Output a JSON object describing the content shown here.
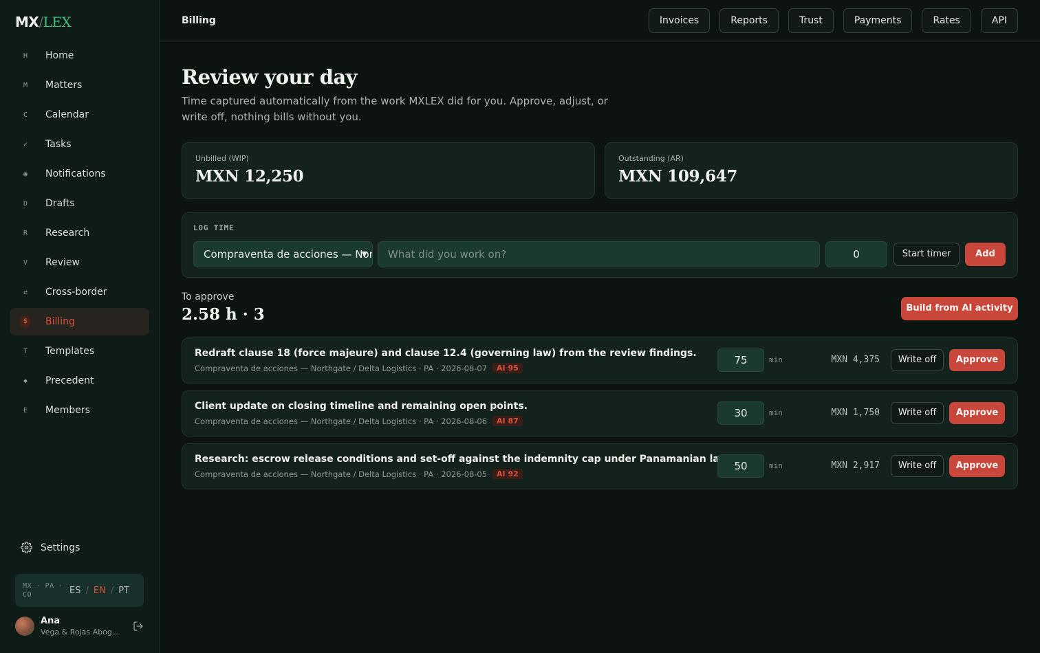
{
  "brand": {
    "mx": "MX",
    "slash": "/",
    "lex": "LEX"
  },
  "sidebar": {
    "items": [
      {
        "icon": "H",
        "label": "Home"
      },
      {
        "icon": "M",
        "label": "Matters"
      },
      {
        "icon": "C",
        "label": "Calendar"
      },
      {
        "icon": "✓",
        "label": "Tasks"
      },
      {
        "icon": "◉",
        "label": "Notifications"
      },
      {
        "icon": "D",
        "label": "Drafts"
      },
      {
        "icon": "R",
        "label": "Research"
      },
      {
        "icon": "V",
        "label": "Review"
      },
      {
        "icon": "⇄",
        "label": "Cross-border"
      },
      {
        "icon": "$",
        "label": "Billing",
        "active": true
      },
      {
        "icon": "T",
        "label": "Templates"
      },
      {
        "icon": "◆",
        "label": "Precedent"
      },
      {
        "icon": "E",
        "label": "Members"
      }
    ],
    "settings_label": "Settings",
    "regions": "MX · PA · CO",
    "languages": [
      "ES",
      "EN",
      "PT"
    ],
    "active_language": "EN",
    "user": {
      "name": "Ana",
      "firm": "Vega & Rojas Abog..."
    }
  },
  "topbar": {
    "breadcrumb": "Billing",
    "tabs": [
      "Invoices",
      "Reports",
      "Trust",
      "Payments",
      "Rates",
      "API"
    ]
  },
  "page": {
    "title": "Review your day",
    "subtitle": "Time captured automatically from the work MXLEX did for you. Approve, adjust, or write off, nothing bills without you."
  },
  "kpis": {
    "unbilled": {
      "label": "Unbilled (WIP)",
      "value": "MXN 12,250"
    },
    "outstanding": {
      "label": "Outstanding (AR)",
      "value": "MXN 109,647"
    }
  },
  "log_time": {
    "label": "LOG TIME",
    "matter_value": "Compraventa de acciones — Northgate / Delta Logistics",
    "description_placeholder": "What did you work on?",
    "minutes_value": "0",
    "start_timer_label": "Start timer",
    "add_label": "Add"
  },
  "to_approve": {
    "label": "To approve",
    "summary": "2.58 h · 3",
    "build_label": "Build from AI activity"
  },
  "entries": [
    {
      "description": "Redraft clause 18 (force majeure) and clause 12.4 (governing law) from the review findings.",
      "meta": "Compraventa de acciones — Northgate / Delta Logistics · PA · 2026-08-07",
      "ai": "AI 95",
      "minutes": "75",
      "unit": "min",
      "amount": "MXN 4,375",
      "write_off": "Write off",
      "approve": "Approve"
    },
    {
      "description": "Client update on closing timeline and remaining open points.",
      "meta": "Compraventa de acciones — Northgate / Delta Logistics · PA · 2026-08-06",
      "ai": "AI 87",
      "minutes": "30",
      "unit": "min",
      "amount": "MXN 1,750",
      "write_off": "Write off",
      "approve": "Approve"
    },
    {
      "description": "Research: escrow release conditions and set-off against the indemnity cap under Panamanian law.",
      "meta": "Compraventa de acciones — Northgate / Delta Logistics · PA · 2026-08-05",
      "ai": "AI 92",
      "minutes": "50",
      "unit": "min",
      "amount": "MXN 2,917",
      "write_off": "Write off",
      "approve": "Approve"
    }
  ],
  "colors": {
    "background": "#0c1411",
    "sidebar": "#0f1b17",
    "accent_red": "#c8463a",
    "brand_green": "#3fbf7f",
    "panel": "#14221d"
  }
}
